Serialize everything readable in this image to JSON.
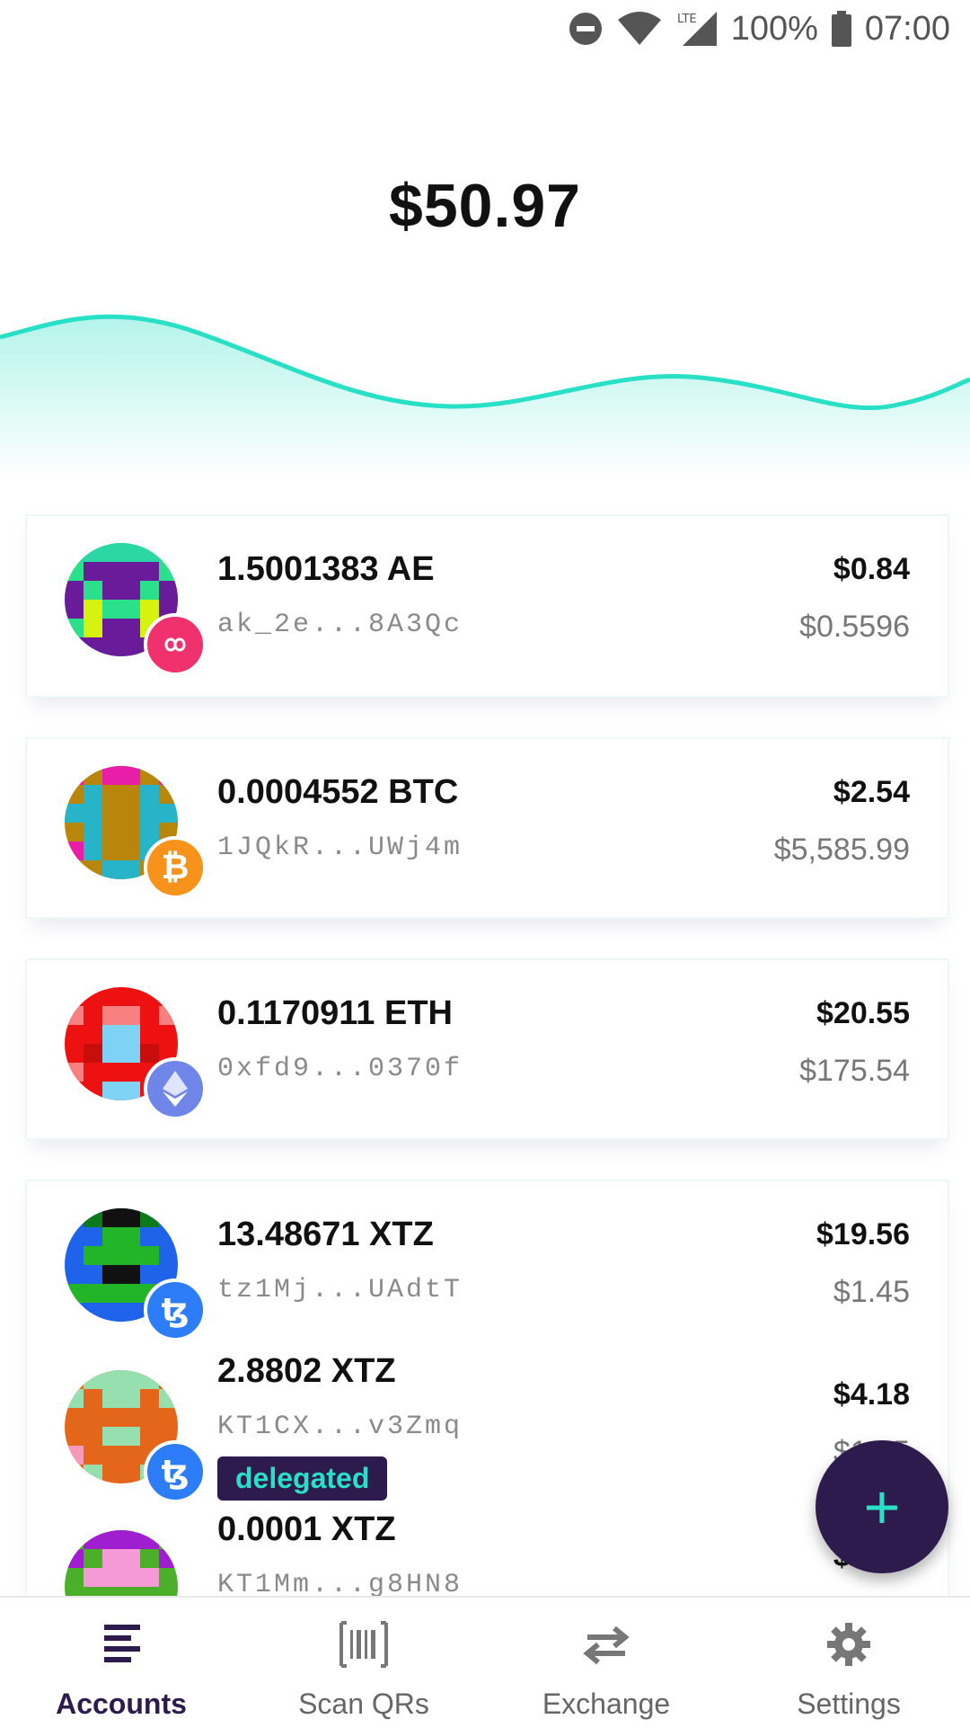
{
  "status": {
    "battery": "100%",
    "time": "07:00",
    "network": "LTE"
  },
  "total_balance": "$50.97",
  "accounts": [
    {
      "amount": "1.5001383 AE",
      "address": "ak_2e...8A3Qc",
      "fiat": "$0.84",
      "price": "$0.5596",
      "coin_icon": "aeternity-icon"
    },
    {
      "amount": "0.0004552 BTC",
      "address": "1JQkR...UWj4m",
      "fiat": "$2.54",
      "price": "$5,585.99",
      "coin_icon": "bitcoin-icon"
    },
    {
      "amount": "0.1170911 ETH",
      "address": "0xfd9...0370f",
      "fiat": "$20.55",
      "price": "$175.54",
      "coin_icon": "ethereum-icon"
    },
    {
      "amount": "13.48671 XTZ",
      "address": "tz1Mj...UAdtT",
      "fiat": "$19.56",
      "price": "$1.45",
      "coin_icon": "tezos-icon"
    },
    {
      "amount": "2.8802 XTZ",
      "address": "KT1CX...v3Zmq",
      "fiat": "$4.18",
      "price": "$1.45",
      "tag": "delegated",
      "coin_icon": "tezos-icon"
    },
    {
      "amount": "0.0001 XTZ",
      "address": "KT1Mm...g8HN8",
      "fiat": "$0.00",
      "coin_icon": "tezos-icon"
    }
  ],
  "fab_label": "+",
  "nav": [
    {
      "label": "Accounts",
      "icon": "list-icon",
      "active": true
    },
    {
      "label": "Scan QRs",
      "icon": "barcode-icon"
    },
    {
      "label": "Exchange",
      "icon": "swap-arrows-icon"
    },
    {
      "label": "Settings",
      "icon": "gear-icon"
    }
  ],
  "colors": {
    "accent": "#27e0c5",
    "primary": "#2d1b4e"
  }
}
